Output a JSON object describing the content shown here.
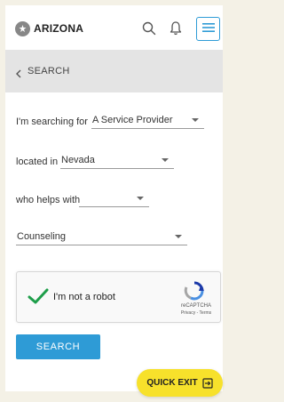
{
  "header": {
    "logo_text": "ARIZONA",
    "icons": [
      "logo-mark-icon",
      "search-icon",
      "bell-icon",
      "hamburger-menu-icon"
    ],
    "accent_color": "#2e9bd6"
  },
  "back": {
    "label": "SEARCH",
    "icon": "chevron-left-icon"
  },
  "form": {
    "searching_for_label": "I'm searching for",
    "searching_for_value": "A Service Provider",
    "located_in_label": "located in",
    "located_in_value": "Nevada",
    "helps_with_label": "who helps with",
    "helps_with_value": "",
    "category_value": "Counseling"
  },
  "captcha": {
    "label": "I'm not a robot",
    "brand": "reCAPTCHA",
    "terms": "Privacy - Terms",
    "checked": true,
    "check_color": "#1e9e4a"
  },
  "actions": {
    "search_label": "SEARCH",
    "quick_exit_label": "QUICK EXIT",
    "quick_exit_color": "#f7e12b"
  }
}
